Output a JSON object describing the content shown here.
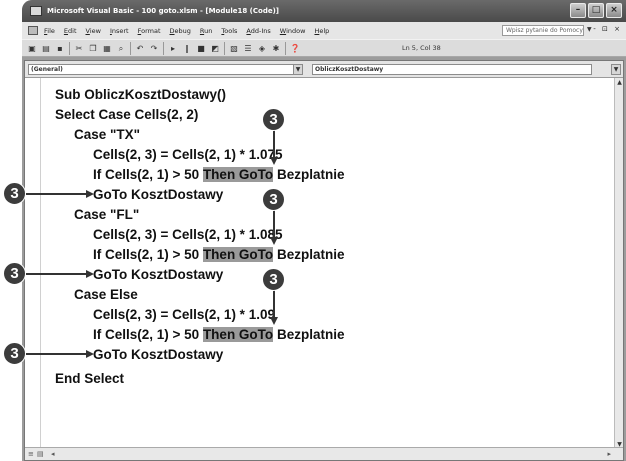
{
  "window": {
    "title": "Microsoft Visual Basic - 100 goto.xlsm - [Module18 (Code)]"
  },
  "menu": {
    "items": [
      "File",
      "Edit",
      "View",
      "Insert",
      "Format",
      "Debug",
      "Run",
      "Tools",
      "Add-Ins",
      "Window",
      "Help"
    ],
    "help_placeholder": "Wpisz pytanie do Pomocy"
  },
  "toolbar": {
    "cursor_position": "Ln 5, Col 38"
  },
  "code_window": {
    "object_combo": "(General)",
    "procedure_combo": "ObliczKosztDostawy"
  },
  "code": {
    "l1": "Sub ObliczKosztDostawy()",
    "l2": "Select Case Cells(2, 2)",
    "l3": "Case \"TX\"",
    "l4": "Cells(2, 3) = Cells(2, 1) * 1.075",
    "l5a": "If Cells(2, 1) > 50 ",
    "l5b": "Then GoTo",
    "l5c": " Bezplatnie",
    "l6": "GoTo KosztDostawy",
    "l7": "Case \"FL\"",
    "l8": "Cells(2, 3) = Cells(2, 1) * 1.085",
    "l9a": "If Cells(2, 1) > 50 ",
    "l9b": "Then GoTo",
    "l9c": " Bezplatnie",
    "l10": "GoTo KosztDostawy",
    "l11": "Case Else",
    "l12": "Cells(2, 3) = Cells(2, 1) * 1.09",
    "l13a": "If Cells(2, 1) > 50 ",
    "l13b": "Then GoTo",
    "l13c": " Bezplatnie",
    "l14": "GoTo KosztDostawy",
    "l15": "End Select"
  },
  "callouts": {
    "number": "3"
  }
}
